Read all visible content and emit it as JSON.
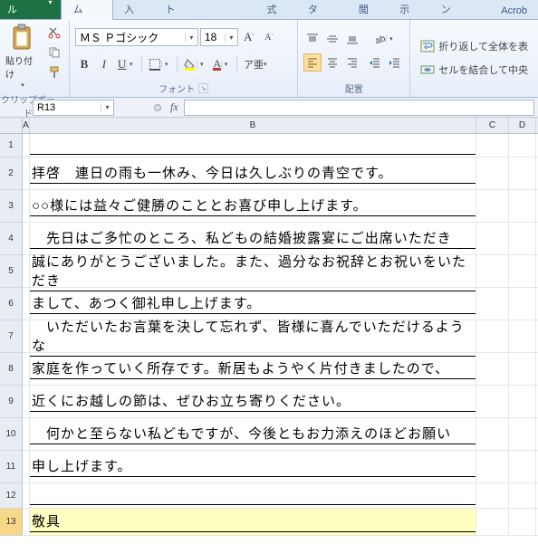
{
  "tabs": {
    "file": "ファイル",
    "items": [
      "ホーム",
      "挿入",
      "ページ レイアウト",
      "数式",
      "データ",
      "校閲",
      "表示",
      "アドイン",
      "Acrob"
    ]
  },
  "ribbon": {
    "clipboard": {
      "paste": "貼り付け",
      "label": "クリップボード"
    },
    "font": {
      "name": "ＭＳ Ｐゴシック",
      "size": "18",
      "grow": "A",
      "shrink": "A",
      "bold": "B",
      "italic": "I",
      "underline": "U",
      "label": "フォント",
      "fontcolor": "A"
    },
    "align": {
      "label": "配置"
    },
    "wrapmerge": {
      "wrap": "折り返して全体を表",
      "merge": "セルを結合して中央"
    }
  },
  "namebox": "R13",
  "fx": "fx",
  "columns": [
    "A",
    "B",
    "C",
    "D"
  ],
  "rows": {
    "r1": "",
    "r2": "拝啓　連日の雨も一休み、今日は久しぶりの青空です。",
    "r3": "○○様には益々ご健勝のこととお喜び申し上げます。",
    "r4": "　先日はご多忙のところ、私どもの結婚披露宴にご出席いただき",
    "r5": "誠にありがとうございました。また、過分なお祝辞とお祝いをいただき",
    "r6": "まして、あつく御礼申し上げます。",
    "r7": "　いただいたお言葉を決して忘れず、皆様に喜んでいただけるような",
    "r8": "家庭を作っていく所存です。新居もようやく片付きましたので、",
    "r9": "近くにお越しの節は、ぜひお立ち寄りください。",
    "r10": "　何かと至らない私どもですが、今後ともお力添えのほどお願い",
    "r11": "申し上げます。",
    "r12": "",
    "r13": "敬具"
  },
  "row_numbers": [
    "1",
    "2",
    "3",
    "4",
    "5",
    "6",
    "7",
    "8",
    "9",
    "10",
    "11",
    "12",
    "13"
  ]
}
